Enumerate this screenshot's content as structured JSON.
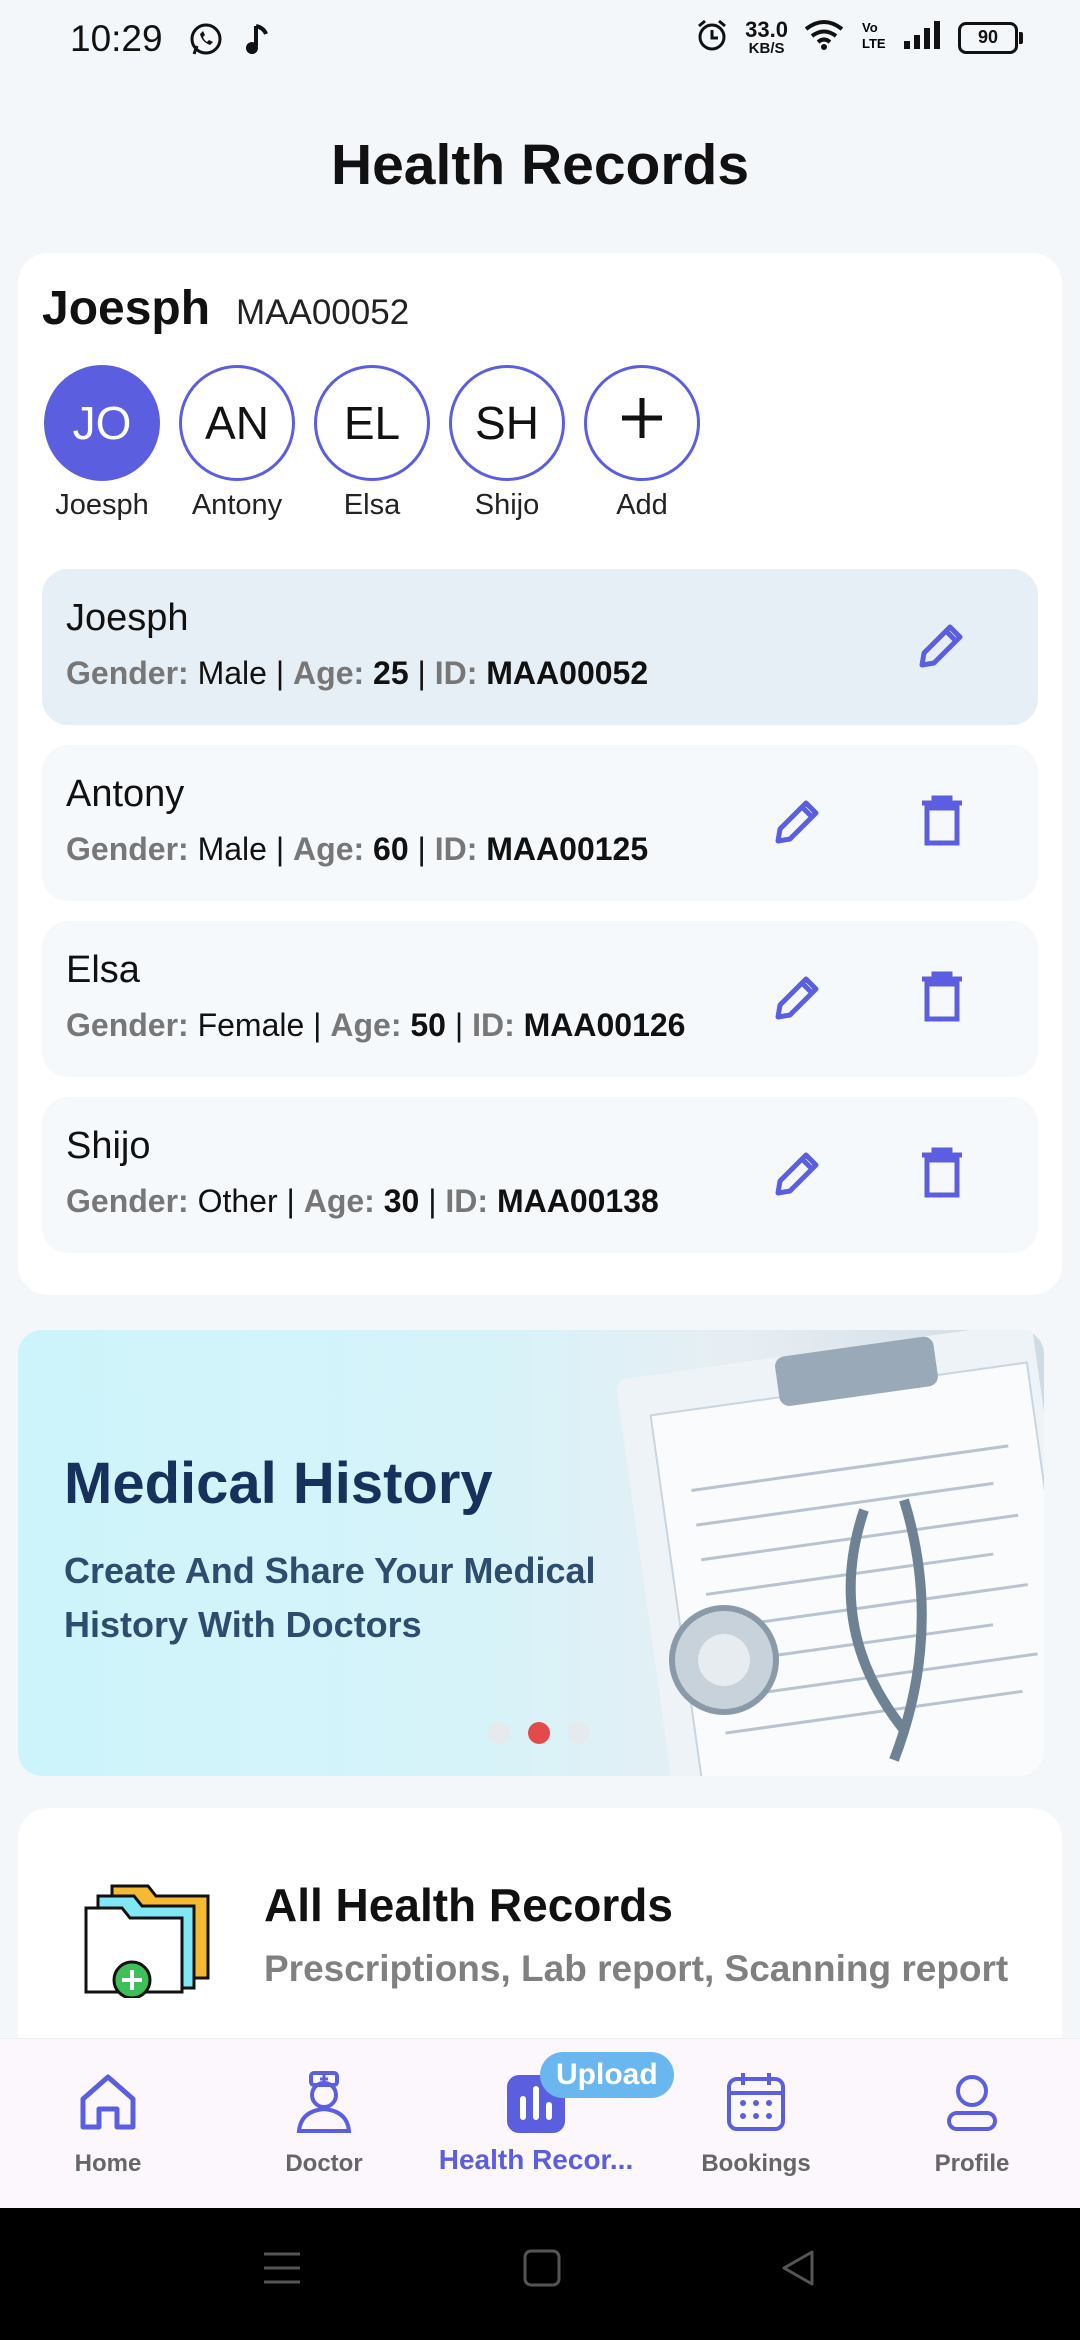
{
  "status_bar": {
    "time": "10:29",
    "net_speed_value": "33.0",
    "net_speed_unit": "KB/S",
    "battery": "90",
    "icons": [
      "whatsapp-icon",
      "music-icon",
      "alarm-icon",
      "wifi-icon",
      "volte-icon",
      "signal-icon",
      "battery-icon"
    ]
  },
  "page": {
    "title": "Health Records"
  },
  "selected": {
    "name": "Joesph",
    "id": "MAA00052"
  },
  "avatars": [
    {
      "initials": "JO",
      "label": "Joesph"
    },
    {
      "initials": "AN",
      "label": "Antony"
    },
    {
      "initials": "EL",
      "label": "Elsa"
    },
    {
      "initials": "SH",
      "label": "Shijo"
    },
    {
      "initials": "+",
      "label": "Add"
    }
  ],
  "meta_keys": {
    "gender": "Gender:",
    "age": "Age:",
    "id": "ID:",
    "sep": "|"
  },
  "members": [
    {
      "name": "Joesph",
      "gender": "Male",
      "age": "25",
      "id": "MAA00052"
    },
    {
      "name": "Antony",
      "gender": "Male",
      "age": "60",
      "id": "MAA00125"
    },
    {
      "name": "Elsa",
      "gender": "Female",
      "age": "50",
      "id": "MAA00126"
    },
    {
      "name": "Shijo",
      "gender": "Other",
      "age": "30",
      "id": "MAA00138"
    }
  ],
  "banner": {
    "title": "Medical History",
    "subtitle": "Create And Share Your Medical History With Doctors",
    "slide_index": 2,
    "slide_count": 3
  },
  "records": {
    "title": "All Health Records",
    "subtitle": "Prescriptions, Lab report, Scanning report"
  },
  "nav": {
    "items": [
      {
        "label": "Home"
      },
      {
        "label": "Doctor"
      },
      {
        "label": "Health Recor..."
      },
      {
        "label": "Bookings"
      },
      {
        "label": "Profile"
      }
    ],
    "upload_badge": "Upload"
  },
  "colors": {
    "accent": "#5b5fdf",
    "badge": "#6ab6ef",
    "dot_active": "#e34b4b"
  }
}
